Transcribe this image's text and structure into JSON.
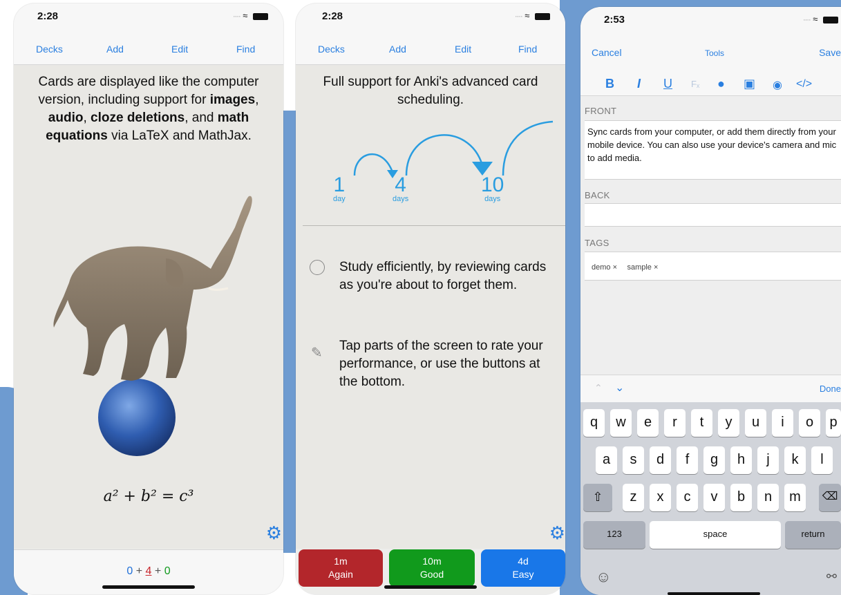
{
  "colors": {
    "accent": "#2a7fe0",
    "again": "#b3262b",
    "good": "#119a1c",
    "easy": "#1977e8",
    "backdrop": "#6e9bd0"
  },
  "phone1": {
    "time": "2:28",
    "nav": [
      "Decks",
      "Add",
      "Edit",
      "Find"
    ],
    "card_text": {
      "intro": "Cards are displayed like the computer version, including support for ",
      "b1": "images",
      "s1": ", ",
      "b2": "audio",
      "s2": ", ",
      "b3": "cloze deletions",
      "s3": ", and ",
      "b4": "math equations",
      "s4": " via LaTeX and MathJax."
    },
    "equation": "a² + b² = c³",
    "counts": {
      "new": "0",
      "plus1": " + ",
      "learn": "4",
      "plus2": " + ",
      "review": "0"
    },
    "icons": {
      "settings": "gear-icon",
      "image": "elephant-on-ball"
    }
  },
  "phone2": {
    "time": "2:28",
    "nav": [
      "Decks",
      "Add",
      "Edit",
      "Find"
    ],
    "heading": "Full support for Anki's advanced card scheduling.",
    "intervals": [
      {
        "value": "1",
        "unit": "day"
      },
      {
        "value": "4",
        "unit": "days"
      },
      {
        "value": "10",
        "unit": "days"
      }
    ],
    "tip1": "Study efficiently, by reviewing cards as you're about to forget them.",
    "tip2": "Tap parts of the screen to rate your performance, or use the buttons at the bottom.",
    "answer_buttons": [
      {
        "time": "1m",
        "label": "Again"
      },
      {
        "time": "10m",
        "label": "Good"
      },
      {
        "time": "4d",
        "label": "Easy"
      }
    ],
    "icons": {
      "tip1": "clock-icon",
      "tip2": "tap-finger-icon",
      "settings": "gear-icon"
    }
  },
  "phone3": {
    "time": "2:53",
    "nav": {
      "cancel": "Cancel",
      "title": "Tools",
      "save": "Save"
    },
    "toolbar": {
      "bold": "B",
      "italic": "I",
      "underline": "U",
      "clear": "Fₓ"
    },
    "front_label": "FRONT",
    "front_value": "Sync cards from your computer, or add them directly from your mobile device. You can also use your device's camera and mic to add media.",
    "back_label": "BACK",
    "back_value": "",
    "tags_label": "TAGS",
    "tags": [
      "demo ×",
      "sample ×"
    ],
    "keyboard": {
      "done": "Done",
      "row1": [
        "q",
        "w",
        "e",
        "r",
        "t",
        "y",
        "u",
        "i",
        "o",
        "p"
      ],
      "row2": [
        "a",
        "s",
        "d",
        "f",
        "g",
        "h",
        "j",
        "k",
        "l"
      ],
      "row3": [
        "z",
        "x",
        "c",
        "v",
        "b",
        "n",
        "m"
      ],
      "numbers": "123",
      "space": "space",
      "return": "return"
    }
  }
}
